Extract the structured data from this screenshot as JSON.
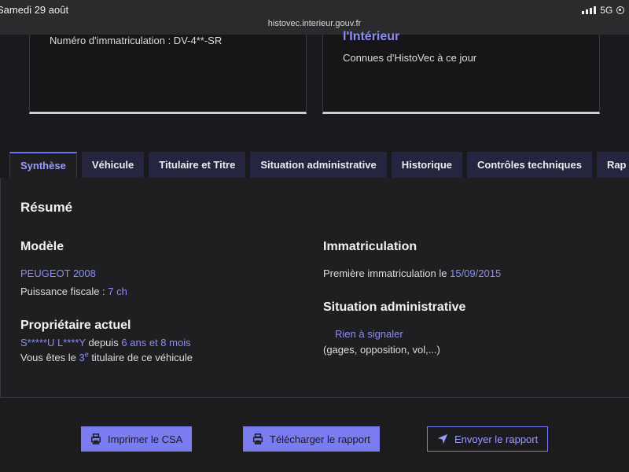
{
  "status_bar": {
    "date": "Samedi 29 août",
    "network": "5G",
    "battery_text": "2"
  },
  "browser": {
    "url": "histovec.interieur.gouv.fr"
  },
  "cards": {
    "left": {
      "plate_line": "Numéro d'immatriculation : DV-4**-SR"
    },
    "right": {
      "title": "l'Intérieur",
      "subtitle": "Connues d'HistoVec à ce jour"
    }
  },
  "tabs": [
    {
      "label": "Synthèse",
      "active": true
    },
    {
      "label": "Véhicule",
      "active": false
    },
    {
      "label": "Titulaire et Titre",
      "active": false
    },
    {
      "label": "Situation administrative",
      "active": false
    },
    {
      "label": "Historique",
      "active": false
    },
    {
      "label": "Contrôles techniques",
      "active": false
    },
    {
      "label": "Rap",
      "active": false
    }
  ],
  "summary": {
    "heading": "Résumé",
    "modele": {
      "heading": "Modèle",
      "model": "PEUGEOT 2008",
      "power_label": "Puissance fiscale : ",
      "power_value": "7 ch"
    },
    "proprietaire": {
      "heading": "Propriétaire actuel",
      "name": "S*****U L****Y",
      "since_label": " depuis ",
      "since_value": "6 ans et 8 mois",
      "rank_prefix": "Vous êtes le ",
      "rank_number": "3",
      "rank_sup": "e",
      "rank_suffix": " titulaire de ce véhicule"
    },
    "immatriculation": {
      "heading": "Immatriculation",
      "first_label": "Première immatriculation le ",
      "first_date": "15/09/2015"
    },
    "situation": {
      "heading": "Situation administrative",
      "status": "Rien à signaler",
      "details": "(gages, opposition, vol,...)"
    }
  },
  "actions": {
    "print_label": "Imprimer le CSA",
    "download_label": "Télécharger le rapport",
    "send_label": "Envoyer le rapport"
  },
  "colors": {
    "accent": "#8b8cf5",
    "button": "#7b7cf0",
    "background": "#1a1a1e"
  }
}
